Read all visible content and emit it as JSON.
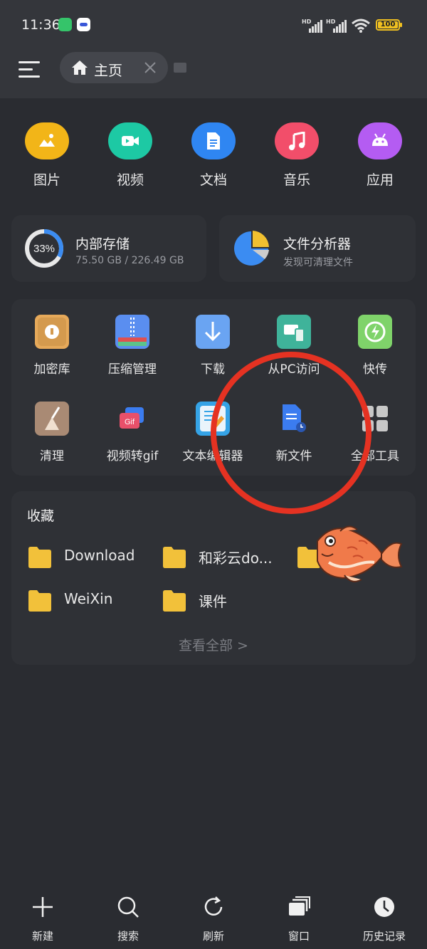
{
  "status_bar": {
    "time": "11:36",
    "network_1": "HD",
    "network_2": "HD",
    "battery": "100"
  },
  "header": {
    "menu_icon": "hamburger-menu-icon",
    "tab_label": "主页",
    "tab_icon": "home-icon",
    "tab_close_icon": "close-icon"
  },
  "categories": [
    {
      "label": "图片",
      "icon": "image-icon",
      "color": "#f2b518"
    },
    {
      "label": "视频",
      "icon": "video-icon",
      "color": "#1dc9a4"
    },
    {
      "label": "文档",
      "icon": "document-icon",
      "color": "#2f86f2"
    },
    {
      "label": "音乐",
      "icon": "music-icon",
      "color": "#f24e6a"
    },
    {
      "label": "应用",
      "icon": "android-icon",
      "color": "#b45cf2"
    }
  ],
  "storage": {
    "title": "内部存储",
    "percent": "33%",
    "used_fraction": 0.33,
    "usage": "75.50 GB / 226.49 GB"
  },
  "analyzer": {
    "title": "文件分析器",
    "subtitle": "发现可清理文件"
  },
  "tools": [
    {
      "label": "加密库",
      "icon": "safe-icon",
      "color": "#e6a95a"
    },
    {
      "label": "压缩管理",
      "icon": "zip-icon",
      "color": "#5a8ef0"
    },
    {
      "label": "下载",
      "icon": "download-icon",
      "color": "#6aa4f2"
    },
    {
      "label": "从PC访问",
      "icon": "pc-access-icon",
      "color": "#3fb39a"
    },
    {
      "label": "快传",
      "icon": "quick-transfer-icon",
      "color": "#7fd36a"
    },
    {
      "label": "清理",
      "icon": "broom-icon",
      "color": "#a98a74"
    },
    {
      "label": "视频转gif",
      "icon": "gif-icon",
      "color": "#e8506a"
    },
    {
      "label": "文本编辑器",
      "icon": "text-editor-icon",
      "color": "#35a3e6"
    },
    {
      "label": "新文件",
      "icon": "new-file-icon",
      "color": "#3b7cf0"
    },
    {
      "label": "全部工具",
      "icon": "grid-icon",
      "color": "#c8c8c8"
    }
  ],
  "favorites": {
    "title": "收藏",
    "items": [
      "Download",
      "和彩云do...",
      "",
      "WeiXin",
      "课件"
    ],
    "view_all": "查看全部 >"
  },
  "bottom_nav": [
    {
      "label": "新建",
      "icon": "plus-icon"
    },
    {
      "label": "搜索",
      "icon": "search-icon"
    },
    {
      "label": "刷新",
      "icon": "refresh-icon"
    },
    {
      "label": "窗口",
      "icon": "windows-icon"
    },
    {
      "label": "历史记录",
      "icon": "clock-icon"
    }
  ]
}
